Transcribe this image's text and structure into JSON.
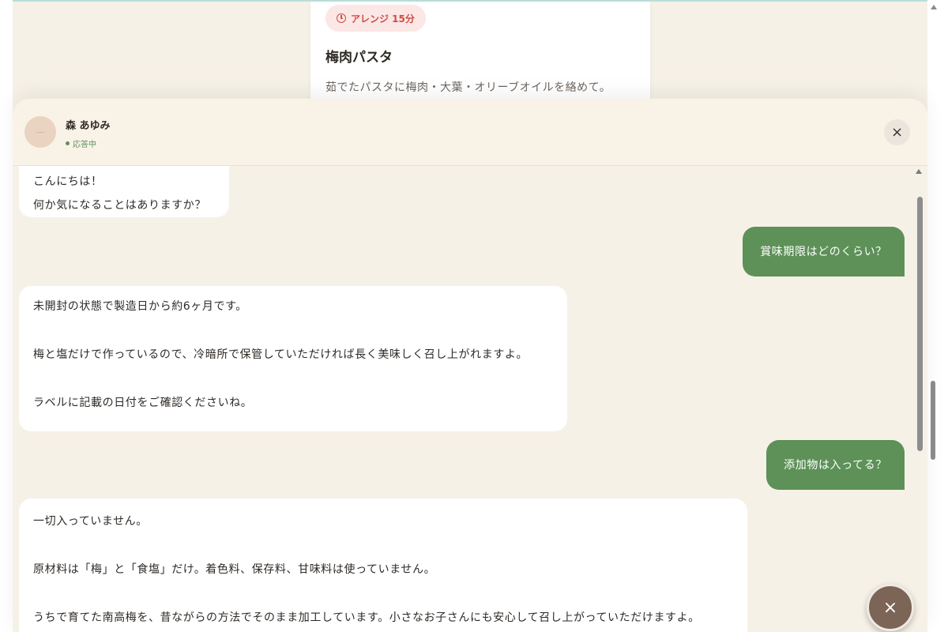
{
  "recipe_card": {
    "badge": "アレンジ 15分",
    "badge_icon": "clock-icon",
    "title": "梅肉パスタ",
    "description": "茹でたパスタに梅肉・大葉・オリーブオイルを絡めて。"
  },
  "chat": {
    "agent_name": "森 あゆみ",
    "agent_status": "応答中",
    "close_icon": "×",
    "messages": [
      {
        "sender": "agent",
        "lines": [
          "こんにちは！",
          "何か気になることはありますか？"
        ]
      },
      {
        "sender": "user",
        "text": "賞味期限はどのくらい？"
      },
      {
        "sender": "agent",
        "paragraphs": [
          "未開封の状態で製造日から約6ヶ月です。",
          "梅と塩だけで作っているので、冷暗所で保管していただければ長く美味しく召し上がれますよ。",
          "ラベルに記載の日付をご確認くださいね。"
        ]
      },
      {
        "sender": "user",
        "text": "添加物は入ってる？"
      },
      {
        "sender": "agent",
        "paragraphs": [
          "一切入っていません。",
          "原材料は「梅」と「食塩」だけ。着色料、保存料、甘味料は使っていません。",
          "うちで育てた南高梅を、昔ながらの方法でそのまま加工しています。小さなお子さんにも安心して召し上がっていただけますよ。"
        ]
      }
    ]
  },
  "fab": {
    "icon": "×"
  },
  "colors": {
    "background": "#f6f1e7",
    "user_bubble": "#5d9158",
    "badge_text": "#cf4b45",
    "fab": "#7c6456"
  }
}
